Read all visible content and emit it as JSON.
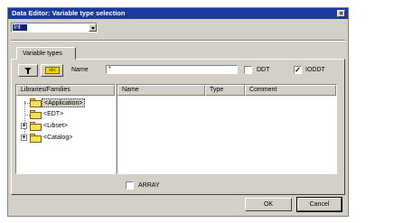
{
  "window": {
    "title": "Data Editor: Variable type selection",
    "close_glyph": "×"
  },
  "type_combo": {
    "selected": "Int"
  },
  "tabs": [
    {
      "label": "Variable types"
    }
  ],
  "toolbar": {
    "filter_icon": "filter-icon",
    "name_filter_icon": "name-filter-icon",
    "name_filter_glyph": "abc"
  },
  "name_filter": {
    "label": "Name",
    "value": "*"
  },
  "ddt": {
    "label": "DDT",
    "checked": false
  },
  "ioddt": {
    "label": "IODDT",
    "checked": true,
    "check_glyph": "✓"
  },
  "libraries": {
    "header": "Libraries/Families",
    "items": [
      {
        "label": "<Application>",
        "expander": "",
        "selected": true
      },
      {
        "label": "<EDT>",
        "expander": "",
        "selected": false
      },
      {
        "label": "<Libset>",
        "expander": "+",
        "selected": false
      },
      {
        "label": "<Catalog>",
        "expander": "+",
        "selected": false
      }
    ]
  },
  "grid": {
    "columns": [
      "Name",
      "Type",
      "Comment"
    ]
  },
  "array": {
    "label": "ARRAY",
    "checked": false
  },
  "buttons": {
    "ok": "OK",
    "cancel": "Cancel"
  }
}
